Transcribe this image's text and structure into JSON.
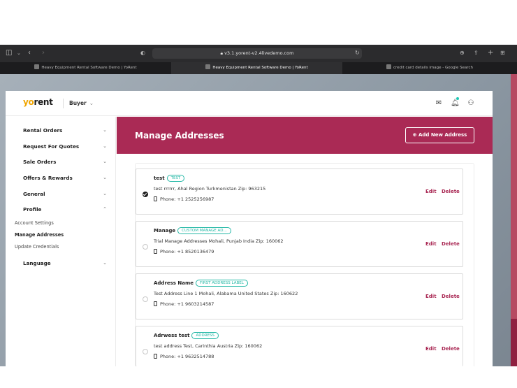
{
  "browser": {
    "url": "v3.1.yorent-v2.4livedemo.com",
    "tabs": [
      {
        "title": "Heavy Equipment Rental Software Demo | YoRent"
      },
      {
        "title": "Heavy Equipment Rental Software Demo | YoRent"
      },
      {
        "title": "credit card details image - Google Search"
      }
    ]
  },
  "header": {
    "logo_prefix": "yo",
    "logo_suffix": "rent",
    "role": "Buyer"
  },
  "sidebar": {
    "items": [
      {
        "label": "Rental Orders"
      },
      {
        "label": "Request For Quotes"
      },
      {
        "label": "Sale Orders"
      },
      {
        "label": "Offers & Rewards"
      },
      {
        "label": "General"
      },
      {
        "label": "Profile"
      },
      {
        "label": "Language"
      }
    ],
    "profile_sub": [
      {
        "label": "Account Settings"
      },
      {
        "label": "Manage Addresses"
      },
      {
        "label": "Update Credentials"
      }
    ]
  },
  "banner": {
    "title": "Manage Addresses",
    "add_button": "Add New Address"
  },
  "addresses": [
    {
      "name": "test",
      "label": "TEST",
      "address": "test rrrrrr, Ahal Region Turkmenistan Zip: 963215",
      "phone": "Phone: +1 2525256987",
      "selected": true
    },
    {
      "name": "Manage",
      "label": "CUSTOM MANAGE AD...",
      "address": "Trial Manage Addresses Mohali, Punjab India Zip: 160062",
      "phone": "Phone: +1 8520136479",
      "selected": false
    },
    {
      "name": "Address Name",
      "label": "FIRST ADDRESS LABEL",
      "address": "Test Address Line 1 Mohali, Alabama United States Zip: 160622",
      "phone": "Phone: +1 9603214587",
      "selected": false
    },
    {
      "name": "Adrwess test",
      "label": "ADDRESS",
      "address": "test address Test, Carinthia Austria Zip: 160062",
      "phone": "Phone: +1 9632514788",
      "selected": false
    }
  ],
  "actions": {
    "edit": "Edit",
    "delete": "Delete"
  },
  "colors": {
    "accent": "#aa2a55",
    "label": "#24b8a6",
    "logo_yo": "#f0a500"
  }
}
